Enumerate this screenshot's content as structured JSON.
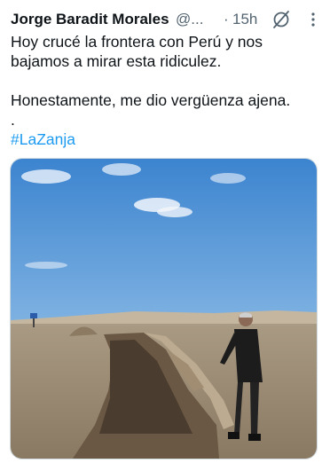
{
  "tweet": {
    "author_name": "Jorge Baradit Morales",
    "handle": "@...",
    "separator": "·",
    "time": "15h",
    "lines": [
      "Hoy crucé la frontera con Perú y nos",
      "bajamos a mirar esta ridiculez.",
      "Honestamente, me dio vergüenza ajena.",
      "."
    ],
    "hashtag": "#LaZanja",
    "icons": [
      "grok-icon",
      "more-options-icon"
    ],
    "colors": {
      "text": "#0f1419",
      "secondary": "#536471",
      "link": "#1d9bf0"
    }
  }
}
